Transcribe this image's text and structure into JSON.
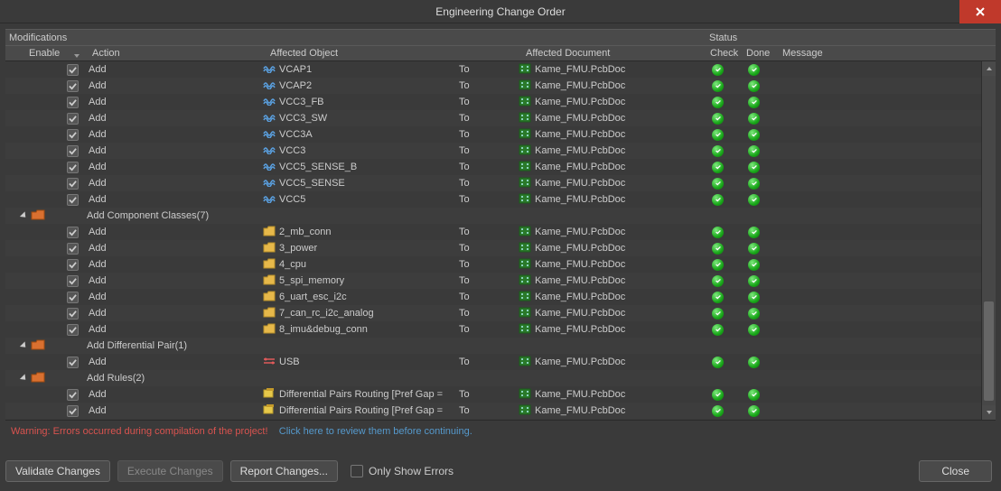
{
  "window": {
    "title": "Engineering Change Order"
  },
  "section": {
    "modifications": "Modifications",
    "status": "Status"
  },
  "columns": {
    "enable": "Enable",
    "action": "Action",
    "object": "Affected Object",
    "document": "Affected Document",
    "check": "Check",
    "done": "Done",
    "message": "Message",
    "to": "To"
  },
  "net_rows": [
    {
      "action": "Add",
      "object": "VCAP1",
      "doc": "Kame_FMU.PcbDoc",
      "check": true,
      "done": true
    },
    {
      "action": "Add",
      "object": "VCAP2",
      "doc": "Kame_FMU.PcbDoc",
      "check": true,
      "done": true
    },
    {
      "action": "Add",
      "object": "VCC3_FB",
      "doc": "Kame_FMU.PcbDoc",
      "check": true,
      "done": true
    },
    {
      "action": "Add",
      "object": "VCC3_SW",
      "doc": "Kame_FMU.PcbDoc",
      "check": true,
      "done": true
    },
    {
      "action": "Add",
      "object": "VCC3A",
      "doc": "Kame_FMU.PcbDoc",
      "check": true,
      "done": true
    },
    {
      "action": "Add",
      "object": "VCC3",
      "doc": "Kame_FMU.PcbDoc",
      "check": true,
      "done": true
    },
    {
      "action": "Add",
      "object": "VCC5_SENSE_B",
      "doc": "Kame_FMU.PcbDoc",
      "check": true,
      "done": true
    },
    {
      "action": "Add",
      "object": "VCC5_SENSE",
      "doc": "Kame_FMU.PcbDoc",
      "check": true,
      "done": true
    },
    {
      "action": "Add",
      "object": "VCC5",
      "doc": "Kame_FMU.PcbDoc",
      "check": true,
      "done": true
    }
  ],
  "group_cc": {
    "label": "Add Component Classes(7)"
  },
  "cc_rows": [
    {
      "action": "Add",
      "object": "2_mb_conn",
      "doc": "Kame_FMU.PcbDoc",
      "check": true,
      "done": true
    },
    {
      "action": "Add",
      "object": "3_power",
      "doc": "Kame_FMU.PcbDoc",
      "check": true,
      "done": true
    },
    {
      "action": "Add",
      "object": "4_cpu",
      "doc": "Kame_FMU.PcbDoc",
      "check": true,
      "done": true
    },
    {
      "action": "Add",
      "object": "5_spi_memory",
      "doc": "Kame_FMU.PcbDoc",
      "check": true,
      "done": true
    },
    {
      "action": "Add",
      "object": "6_uart_esc_i2c",
      "doc": "Kame_FMU.PcbDoc",
      "check": true,
      "done": true
    },
    {
      "action": "Add",
      "object": "7_can_rc_i2c_analog",
      "doc": "Kame_FMU.PcbDoc",
      "check": true,
      "done": true
    },
    {
      "action": "Add",
      "object": "8_imu&debug_conn",
      "doc": "Kame_FMU.PcbDoc",
      "check": true,
      "done": true
    }
  ],
  "group_dp": {
    "label": "Add Differential Pair(1)"
  },
  "dp_rows": [
    {
      "action": "Add",
      "object": "USB",
      "doc": "Kame_FMU.PcbDoc",
      "check": true,
      "done": true
    }
  ],
  "group_rules": {
    "label": "Add Rules(2)"
  },
  "rule_rows": [
    {
      "action": "Add",
      "object": "Differential Pairs Routing [Pref Gap =",
      "doc": "Kame_FMU.PcbDoc",
      "check": true,
      "done": true
    },
    {
      "action": "Add",
      "object": "Differential Pairs Routing [Pref Gap =",
      "doc": "Kame_FMU.PcbDoc",
      "check": true,
      "done": true
    }
  ],
  "warning": {
    "text": "Warning: Errors occurred during compilation of the project!",
    "link": "Click here to review them before continuing."
  },
  "buttons": {
    "validate": "Validate Changes",
    "execute": "Execute Changes",
    "report": "Report Changes...",
    "only_errors": "Only Show Errors",
    "close": "Close"
  }
}
